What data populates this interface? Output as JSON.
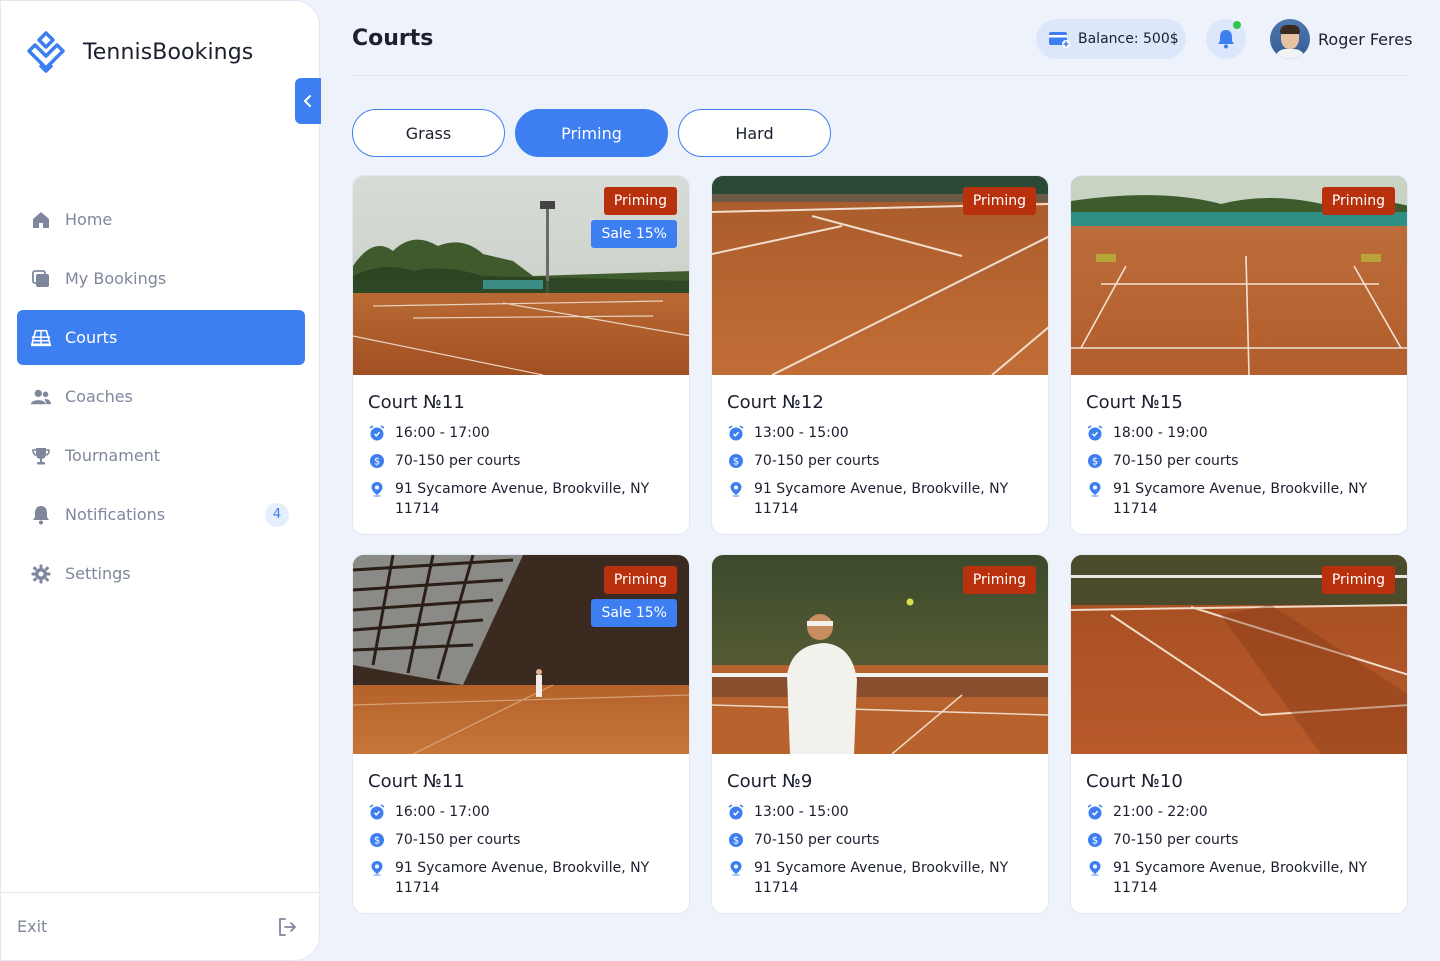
{
  "brand": {
    "name": "TennisBookings",
    "accent": "#3d7ff0"
  },
  "sidebar": {
    "items": [
      {
        "label": "Home",
        "icon": "home-icon"
      },
      {
        "label": "My Bookings",
        "icon": "bookings-icon"
      },
      {
        "label": "Courts",
        "icon": "court-icon",
        "active": true
      },
      {
        "label": "Coaches",
        "icon": "users-icon"
      },
      {
        "label": "Tournament",
        "icon": "trophy-icon"
      },
      {
        "label": "Notifications",
        "icon": "bell-icon",
        "badge": "4"
      },
      {
        "label": "Settings",
        "icon": "gear-icon"
      }
    ],
    "exit_label": "Exit"
  },
  "header": {
    "title": "Courts",
    "balance": "Balance: 500$",
    "user_name": "Roger Feres"
  },
  "filters": [
    {
      "label": "Grass",
      "active": false
    },
    {
      "label": "Priming",
      "active": true
    },
    {
      "label": "Hard",
      "active": false
    }
  ],
  "courts": [
    {
      "name": "Court №11",
      "surface": "Priming",
      "sale": "Sale 15%",
      "time": "16:00 - 17:00",
      "price": "70-150 per courts",
      "address": "91 Sycamore Avenue, Brookville, NY 11714"
    },
    {
      "name": "Court №12",
      "surface": "Priming",
      "sale": "",
      "time": "13:00 - 15:00",
      "price": "70-150 per courts",
      "address": "91 Sycamore Avenue, Brookville, NY 11714"
    },
    {
      "name": "Court №15",
      "surface": "Priming",
      "sale": "",
      "time": "18:00 - 19:00",
      "price": "70-150 per courts",
      "address": "91 Sycamore Avenue, Brookville, NY 11714"
    },
    {
      "name": "Court №11",
      "surface": "Priming",
      "sale": "Sale 15%",
      "time": "16:00 - 17:00",
      "price": "70-150 per courts",
      "address": "91 Sycamore Avenue, Brookville, NY 11714"
    },
    {
      "name": "Court №9",
      "surface": "Priming",
      "sale": "",
      "time": "13:00 - 15:00",
      "price": "70-150 per courts",
      "address": "91 Sycamore Avenue, Brookville, NY 11714"
    },
    {
      "name": "Court №10",
      "surface": "Priming",
      "sale": "",
      "time": "21:00 - 22:00",
      "price": "70-150 per courts",
      "address": "91 Sycamore Avenue, Brookville, NY 11714"
    }
  ]
}
